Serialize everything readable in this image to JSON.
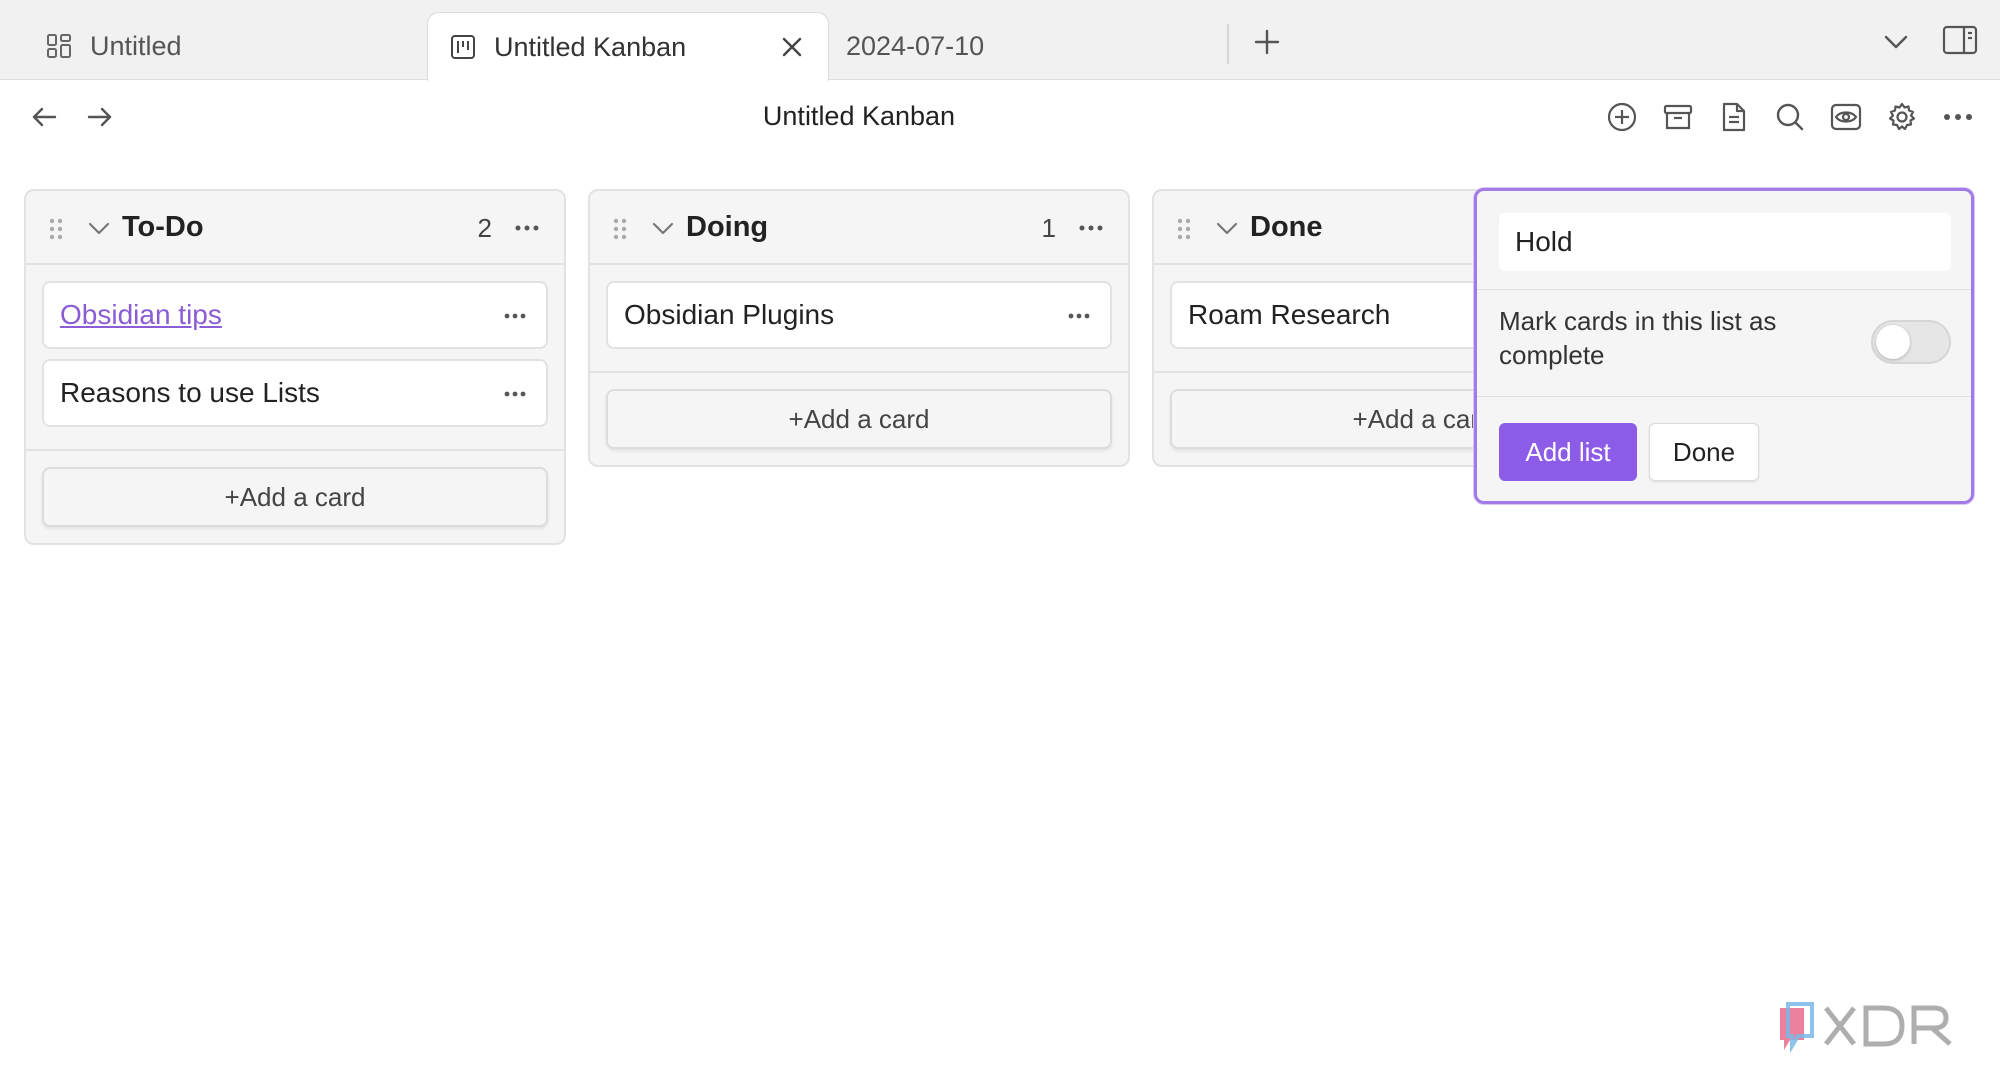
{
  "tabs": [
    {
      "label": "Untitled",
      "icon": "dashboard-icon"
    },
    {
      "label": "Untitled Kanban",
      "icon": "kanban-icon",
      "active": true
    },
    {
      "label": "2024-07-10"
    }
  ],
  "header": {
    "title": "Untitled Kanban",
    "actions": [
      "add-icon",
      "archive-icon",
      "document-icon",
      "search-icon",
      "preview-icon",
      "gear-icon",
      "more-icon"
    ]
  },
  "lanes": [
    {
      "title": "To-Do",
      "count": "2",
      "cards": [
        {
          "text": "Obsidian tips",
          "link": true
        },
        {
          "text": "Reasons to use Lists"
        }
      ],
      "add_label": "+Add a card"
    },
    {
      "title": "Doing",
      "count": "1",
      "cards": [
        {
          "text": "Obsidian Plugins"
        }
      ],
      "add_label": "+Add a card"
    },
    {
      "title": "Done",
      "cards": [
        {
          "text": "Roam Research"
        }
      ],
      "add_label": "+Add a card"
    }
  ],
  "add_list_form": {
    "input_value": "Hold",
    "toggle_label": "Mark cards in this list as complete",
    "toggle_on": false,
    "add_label": "Add list",
    "done_label": "Done"
  },
  "colors": {
    "accent": "#8c5ce8",
    "link": "#8a5cd6",
    "popup_border": "#a27be6"
  }
}
